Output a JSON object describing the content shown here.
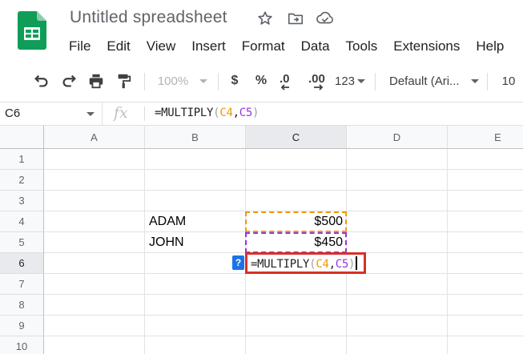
{
  "app": {
    "title": "Untitled spreadsheet",
    "brand_color": "#0f9d58"
  },
  "title_icons": [
    "star-icon",
    "move-to-folder-icon",
    "cloud-status-icon"
  ],
  "menu": [
    "File",
    "Edit",
    "View",
    "Insert",
    "Format",
    "Data",
    "Tools",
    "Extensions",
    "Help"
  ],
  "toolbar": {
    "zoom": "100%",
    "currency": "$",
    "percent": "%",
    "decrease_decimals": ".0",
    "increase_decimals": ".00",
    "more_formats": "123",
    "font": "Default (Ari...",
    "font_size": "10"
  },
  "formula_bar": {
    "cell_ref": "C6",
    "fx": "fx",
    "prefix": "=MULTIPLY",
    "open_paren": "(",
    "ref1": "C4",
    "comma": ",",
    "ref2": "C5",
    "close_paren": ")"
  },
  "grid": {
    "columns": [
      "A",
      "B",
      "C",
      "D",
      "E"
    ],
    "selected_column": "C",
    "rows": [
      "1",
      "2",
      "3",
      "4",
      "5",
      "6",
      "7",
      "8",
      "9",
      "10"
    ],
    "selected_row": "6",
    "cells": {
      "B4": "ADAM",
      "C4": "$500",
      "B5": "JOHN",
      "C5": "$450"
    },
    "range_colors": {
      "C4": "#f29900",
      "C5": "#9334e6",
      "active_edit_border": "#d93025"
    }
  },
  "active_cell": {
    "ref": "C6",
    "prefix": "=MULTIPLY",
    "open_paren": "(",
    "ref1": "C4",
    "comma": ",",
    "ref2": "C5",
    "close_paren": ")",
    "hint_button": "?"
  }
}
